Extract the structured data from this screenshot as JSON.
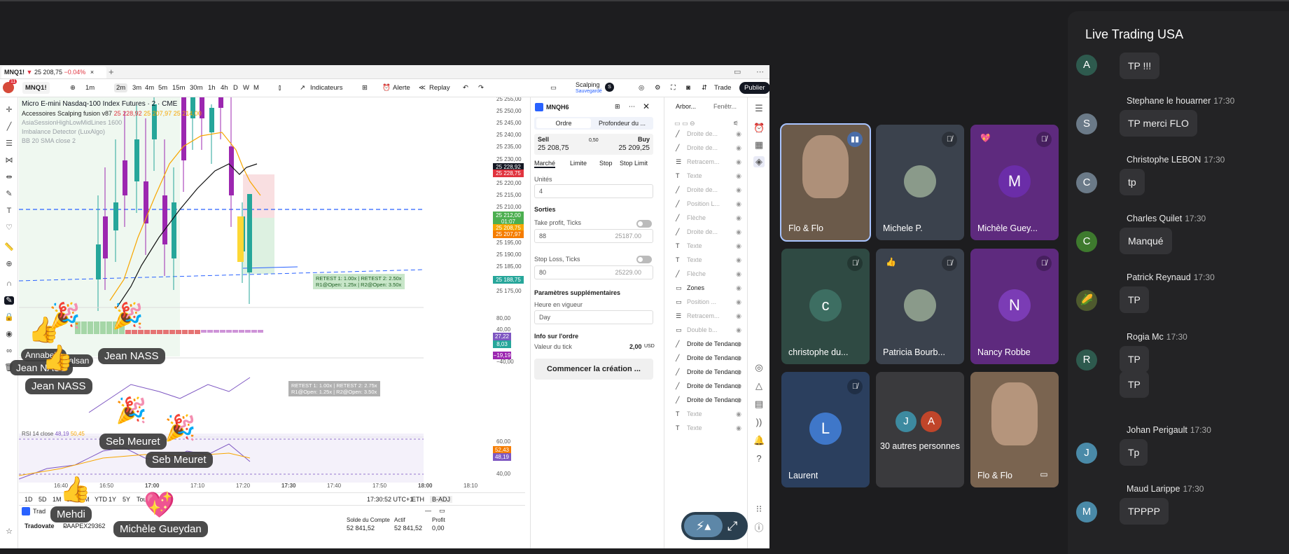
{
  "window": {
    "tab_title": "MNQ1!",
    "tab_price": "25 208,75",
    "tab_change": "−0.04%",
    "tab_close": "×",
    "tab_add": "+"
  },
  "toolbar": {
    "symbol": "MNQ1!",
    "notif_count": "11",
    "intervals": [
      "1m",
      "2m",
      "3m",
      "4m",
      "5m",
      "15m",
      "30m",
      "1h",
      "4h",
      "D",
      "W",
      "M"
    ],
    "selected_interval": "2m",
    "indicators": "Indicateurs",
    "alert": "Alerte",
    "replay": "Replay",
    "layout_name": "Scalping",
    "layout_saved": "Sauvegardé",
    "layout_short": "S",
    "trade": "Trade",
    "publish": "Publier"
  },
  "chart": {
    "title": "Micro E-mini Nasdaq-100 Index Futures · 2 · CME",
    "legend_lines": [
      "Accessoires Scalping fusion v87",
      "AsiaSessionHighLowMidLines 1600",
      "Imbalance Detector (LuxAlgo)",
      "BB 20 SMA close 2"
    ],
    "legend_values": {
      "acc_a": "25 228,92",
      "acc_b": "25 207,97",
      "acc_c": "25 214,00"
    },
    "price_ticks": [
      "25 255,00",
      "25 250,00",
      "25 245,00",
      "25 240,00",
      "25 235,00",
      "25 230,00",
      "25 225,00",
      "25 220,00",
      "25 215,00",
      "25 210,00",
      "25 205,00",
      "25 200,00",
      "25 195,00",
      "25 190,00",
      "25 185,00",
      "25 180,00",
      "25 175,00"
    ],
    "price_tags": [
      {
        "label": "25 228,92",
        "color": "#131722"
      },
      {
        "label": "25 228,75",
        "color": "#e0333e"
      },
      {
        "label": "25 212,00",
        "color": "#4caf50"
      },
      {
        "label": "01:07",
        "color": "#4caf50"
      },
      {
        "label": "25 208,75",
        "color": "#f7a600"
      },
      {
        "label": "25 207,97",
        "color": "#f57c00"
      },
      {
        "label": "25 188,75",
        "color": "#26a69a"
      }
    ],
    "annotation_1": "RETEST 1: 1.00x | RETEST 2: 2.50x",
    "annotation_1b": "R1@Open: 1.25x | R2@Open: 3.50x",
    "annotation_2": "RETEST 1: 1.00x | RETEST 2: 2.75x",
    "annotation_2b": "R1@Open: 1.25x | R2@Open: 3.50x",
    "osc_ticks": [
      "80,00",
      "40,00",
      "−40,00"
    ],
    "osc_tags": [
      {
        "label": "27,22",
        "color": "#7e57c2"
      },
      {
        "label": "8,03",
        "color": "#26a69a"
      },
      {
        "label": "−19,19",
        "color": "#9c27b0"
      }
    ],
    "rsi_label": "RSI 14 close",
    "rsi_value": "48,19",
    "rsi_value2": "50,45",
    "rsi_ticks": [
      "60,00",
      "40,00"
    ],
    "rsi_tags": [
      {
        "label": "52,43",
        "color": "#f57c00"
      },
      {
        "label": "48,19",
        "color": "#7e57c2"
      }
    ],
    "time_ticks": [
      "16:40",
      "16:50",
      "17:00",
      "17:10",
      "17:20",
      "17:30",
      "17:40",
      "17:50",
      "18:00",
      "18:10"
    ],
    "ranges": [
      "1D",
      "5D",
      "1M",
      "3M",
      "6M",
      "YTD",
      "1Y",
      "5Y",
      "Tout"
    ],
    "clock": "17:30:52 UTC+1",
    "session": "ETH",
    "adj": "B-ADJ"
  },
  "account": {
    "broker": "Tradovate",
    "panel_label": "Trad",
    "account_id": "PAAPEX29362",
    "balance_label": "Solde du Compte",
    "balance": "52 841,52",
    "actif_label": "Actif",
    "actif": "52 841,52",
    "profit_label": "Profit",
    "profit": "0,00"
  },
  "order": {
    "symbol": "MNQH6",
    "tab_order": "Ordre",
    "tab_depth": "Profondeur du ...",
    "sell": "Sell",
    "sell_price": "25 208,75",
    "spread": "0,50",
    "buy": "Buy",
    "buy_price": "25 209,25",
    "types": [
      "Marché",
      "Limite",
      "Stop",
      "Stop Limit"
    ],
    "units_label": "Unités",
    "units": "4",
    "sorties": "Sorties",
    "tp_label": "Take profit, Ticks",
    "tp": "88",
    "tp_price": "25187.00",
    "sl_label": "Stop Loss, Ticks",
    "sl": "80",
    "sl_price": "25229.00",
    "extra": "Paramètres supplémentaires",
    "tif_label": "Heure en vigueur",
    "tif": "Day",
    "info": "Info sur l'ordre",
    "tick_label": "Valeur du tick",
    "tick_value": "2,00",
    "tick_cur": "USD",
    "create": "Commencer la création ..."
  },
  "tree": {
    "tab1": "Arbor...",
    "tab2": "Fenêtr...",
    "items": [
      {
        "icon": "╱",
        "label": "Droite de...",
        "dim": true
      },
      {
        "icon": "╱",
        "label": "Droite de...",
        "dim": true
      },
      {
        "icon": "☰",
        "label": "Retracem...",
        "dim": true
      },
      {
        "icon": "T",
        "label": "Texte",
        "dim": true
      },
      {
        "icon": "╱",
        "label": "Droite de...",
        "dim": true
      },
      {
        "icon": "╱",
        "label": "Position L...",
        "dim": true
      },
      {
        "icon": "╱",
        "label": "Flèche",
        "dim": true
      },
      {
        "icon": "╱",
        "label": "Droite de...",
        "dim": true
      },
      {
        "icon": "T",
        "label": "Texte",
        "dim": true
      },
      {
        "icon": "T",
        "label": "Texte",
        "dim": true
      },
      {
        "icon": "╱",
        "label": "Flèche",
        "dim": true
      },
      {
        "icon": "▭",
        "label": "Zones",
        "dim": false
      },
      {
        "icon": "▭",
        "label": "Position ...",
        "dim": true
      },
      {
        "icon": "☰",
        "label": "Retracem...",
        "dim": true
      },
      {
        "icon": "▭",
        "label": "Double b...",
        "dim": true
      },
      {
        "icon": "╱",
        "label": "Droite de Tendance",
        "dim": false
      },
      {
        "icon": "╱",
        "label": "Droite de Tendance",
        "dim": false
      },
      {
        "icon": "╱",
        "label": "Droite de Tendance",
        "dim": false
      },
      {
        "icon": "╱",
        "label": "Droite de Tendance",
        "dim": false
      },
      {
        "icon": "╱",
        "label": "Droite de Tendance",
        "dim": false
      },
      {
        "icon": "T",
        "label": "Texte",
        "dim": true
      },
      {
        "icon": "T",
        "label": "Texte",
        "dim": true
      }
    ]
  },
  "reactions": [
    {
      "name": "Jean NASS"
    },
    {
      "name": "Jean NASS"
    },
    {
      "name": "Jean NASS"
    },
    {
      "name": "Seb Meuret"
    },
    {
      "name": "Seb Meuret"
    },
    {
      "name": "Mehdi"
    },
    {
      "name": "Michèle Gueydan"
    },
    {
      "name": "Annabelle"
    },
    {
      "name": "Calsan"
    }
  ],
  "tiles": [
    {
      "name": "Flo & Flo",
      "bg": "#6b5a4a"
    },
    {
      "name": "Michele P.",
      "bg": "#3b424d"
    },
    {
      "name": "Michèle Guey...",
      "bg": "#5e2a7e",
      "initial": "M",
      "avbg": "#6b2da8"
    },
    {
      "name": "christophe du...",
      "bg": "#2f4a43",
      "initial": "c",
      "avbg": "#3d6e62"
    },
    {
      "name": "Patricia Bourb...",
      "bg": "#3b424d"
    },
    {
      "name": "Nancy Robbe",
      "bg": "#5e2a7e",
      "initial": "N",
      "avbg": "#7b3cb5"
    },
    {
      "name": "Laurent",
      "bg": "#2b3f5e",
      "initial": "L",
      "avbg": "#3f77c9"
    },
    {
      "name": "30 autres personnes",
      "bg": "#3a3a3d"
    },
    {
      "name": "Flo & Flo",
      "bg": "#7a6450"
    }
  ],
  "others": {
    "a": "J",
    "b": "A"
  },
  "chat": {
    "title": "Live Trading USA",
    "messages": [
      {
        "author": "",
        "time": "",
        "text": "TP !!!",
        "initial": "A",
        "color": "#2e5a4e"
      },
      {
        "author": "Stephane le houarner",
        "time": "17:30",
        "text": "TP  merci FLO",
        "initial": "S",
        "color": "#6b7a88"
      },
      {
        "author": "Christophe LEBON",
        "time": "17:30",
        "text": "tp",
        "initial": "C",
        "color": "#6b7a88"
      },
      {
        "author": "Charles Quilet",
        "time": "17:30",
        "text": "Manqué",
        "initial": "C",
        "color": "#3e7a2e"
      },
      {
        "author": "Patrick Reynaud",
        "time": "17:30",
        "text": "TP",
        "initial": "🌽",
        "color": "#4e5a2e"
      },
      {
        "author": "Rogia Mc",
        "time": "17:30",
        "text": "TP",
        "initial": "R",
        "color": "#2e5a4e"
      },
      {
        "author": "",
        "time": "",
        "text": "TP",
        "initial": "",
        "color": ""
      },
      {
        "author": "Johan Perigault",
        "time": "17:30",
        "text": "Tp",
        "initial": "J",
        "color": "#4a8aa8"
      },
      {
        "author": "Maud Larippe",
        "time": "17:30",
        "text": "TPPPP",
        "initial": "M",
        "color": "#4a8aa8"
      }
    ]
  }
}
